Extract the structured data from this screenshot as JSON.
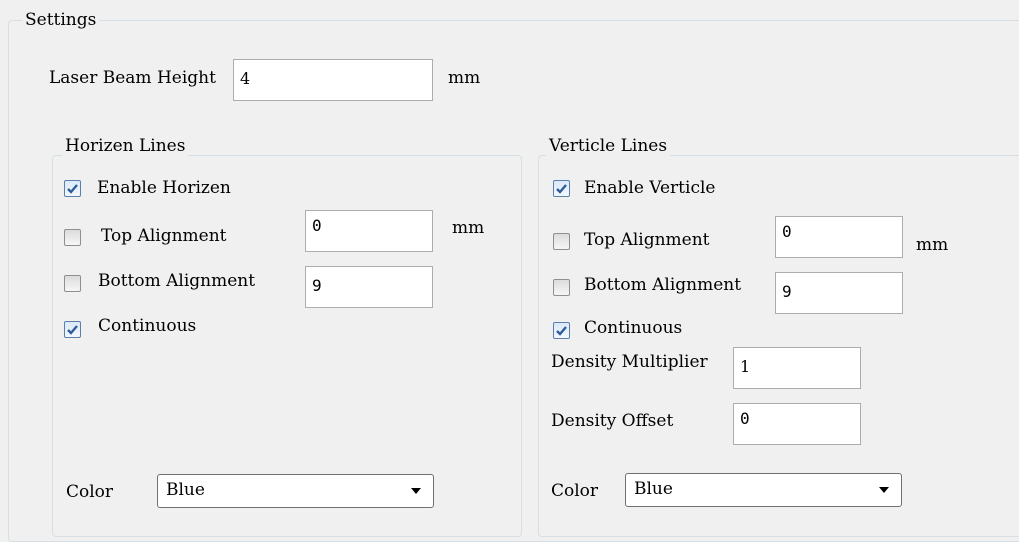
{
  "settings": {
    "title": "Settings",
    "laser_beam_height": {
      "label": "Laser Beam Height",
      "value": "4",
      "unit": "mm"
    }
  },
  "horizon": {
    "title": "Horizen Lines",
    "enable": {
      "label": "Enable Horizen",
      "checked": true
    },
    "top_alignment": {
      "label": "Top Alignment",
      "checked": false,
      "value": "0",
      "unit": "mm"
    },
    "bottom_alignment": {
      "label": "Bottom Alignment",
      "checked": false,
      "value": "9"
    },
    "continuous": {
      "label": "Continuous",
      "checked": true
    },
    "color": {
      "label": "Color",
      "selected": "Blue"
    }
  },
  "vertical": {
    "title": "Verticle Lines",
    "enable": {
      "label": "Enable Verticle",
      "checked": true
    },
    "top_alignment": {
      "label": "Top Alignment",
      "checked": false,
      "value": "0",
      "unit": "mm"
    },
    "bottom_alignment": {
      "label": "Bottom Alignment",
      "checked": false,
      "value": "9"
    },
    "continuous": {
      "label": "Continuous",
      "checked": true
    },
    "density_multiplier": {
      "label": "Density Multiplier",
      "value": "1"
    },
    "density_offset": {
      "label": "Density Offset",
      "value": "0"
    },
    "color": {
      "label": "Color",
      "selected": "Blue"
    }
  },
  "colors": {
    "check_mark": "#2f5d9c",
    "group_border": "#d5dfe5",
    "background": "#f0f0f0"
  },
  "icons": {
    "checkbox_checked": "check-icon",
    "dropdown": "chevron-down-icon"
  }
}
